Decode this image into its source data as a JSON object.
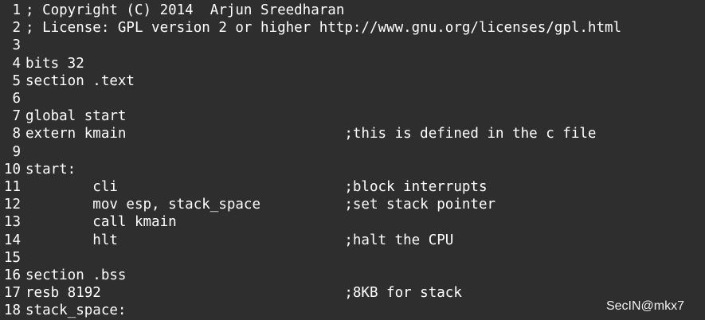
{
  "editor": {
    "lines": [
      {
        "num": "1",
        "text": "; Copyright (C) 2014  Arjun Sreedharan"
      },
      {
        "num": "2",
        "text": "; License: GPL version 2 or higher http://www.gnu.org/licenses/gpl.html"
      },
      {
        "num": "3",
        "text": ""
      },
      {
        "num": "4",
        "text": "bits 32"
      },
      {
        "num": "5",
        "text": "section .text"
      },
      {
        "num": "6",
        "text": ""
      },
      {
        "num": "7",
        "text": "global start"
      },
      {
        "num": "8",
        "text": "extern kmain                          ;this is defined in the c file"
      },
      {
        "num": "9",
        "text": ""
      },
      {
        "num": "10",
        "text": "start:"
      },
      {
        "num": "11",
        "text": "        cli                           ;block interrupts"
      },
      {
        "num": "12",
        "text": "        mov esp, stack_space          ;set stack pointer"
      },
      {
        "num": "13",
        "text": "        call kmain"
      },
      {
        "num": "14",
        "text": "        hlt                           ;halt the CPU"
      },
      {
        "num": "15",
        "text": ""
      },
      {
        "num": "16",
        "text": "section .bss"
      },
      {
        "num": "17",
        "text": "resb 8192                             ;8KB for stack"
      },
      {
        "num": "18",
        "text": "stack_space:"
      }
    ]
  },
  "watermark": "SecIN@mkx7"
}
